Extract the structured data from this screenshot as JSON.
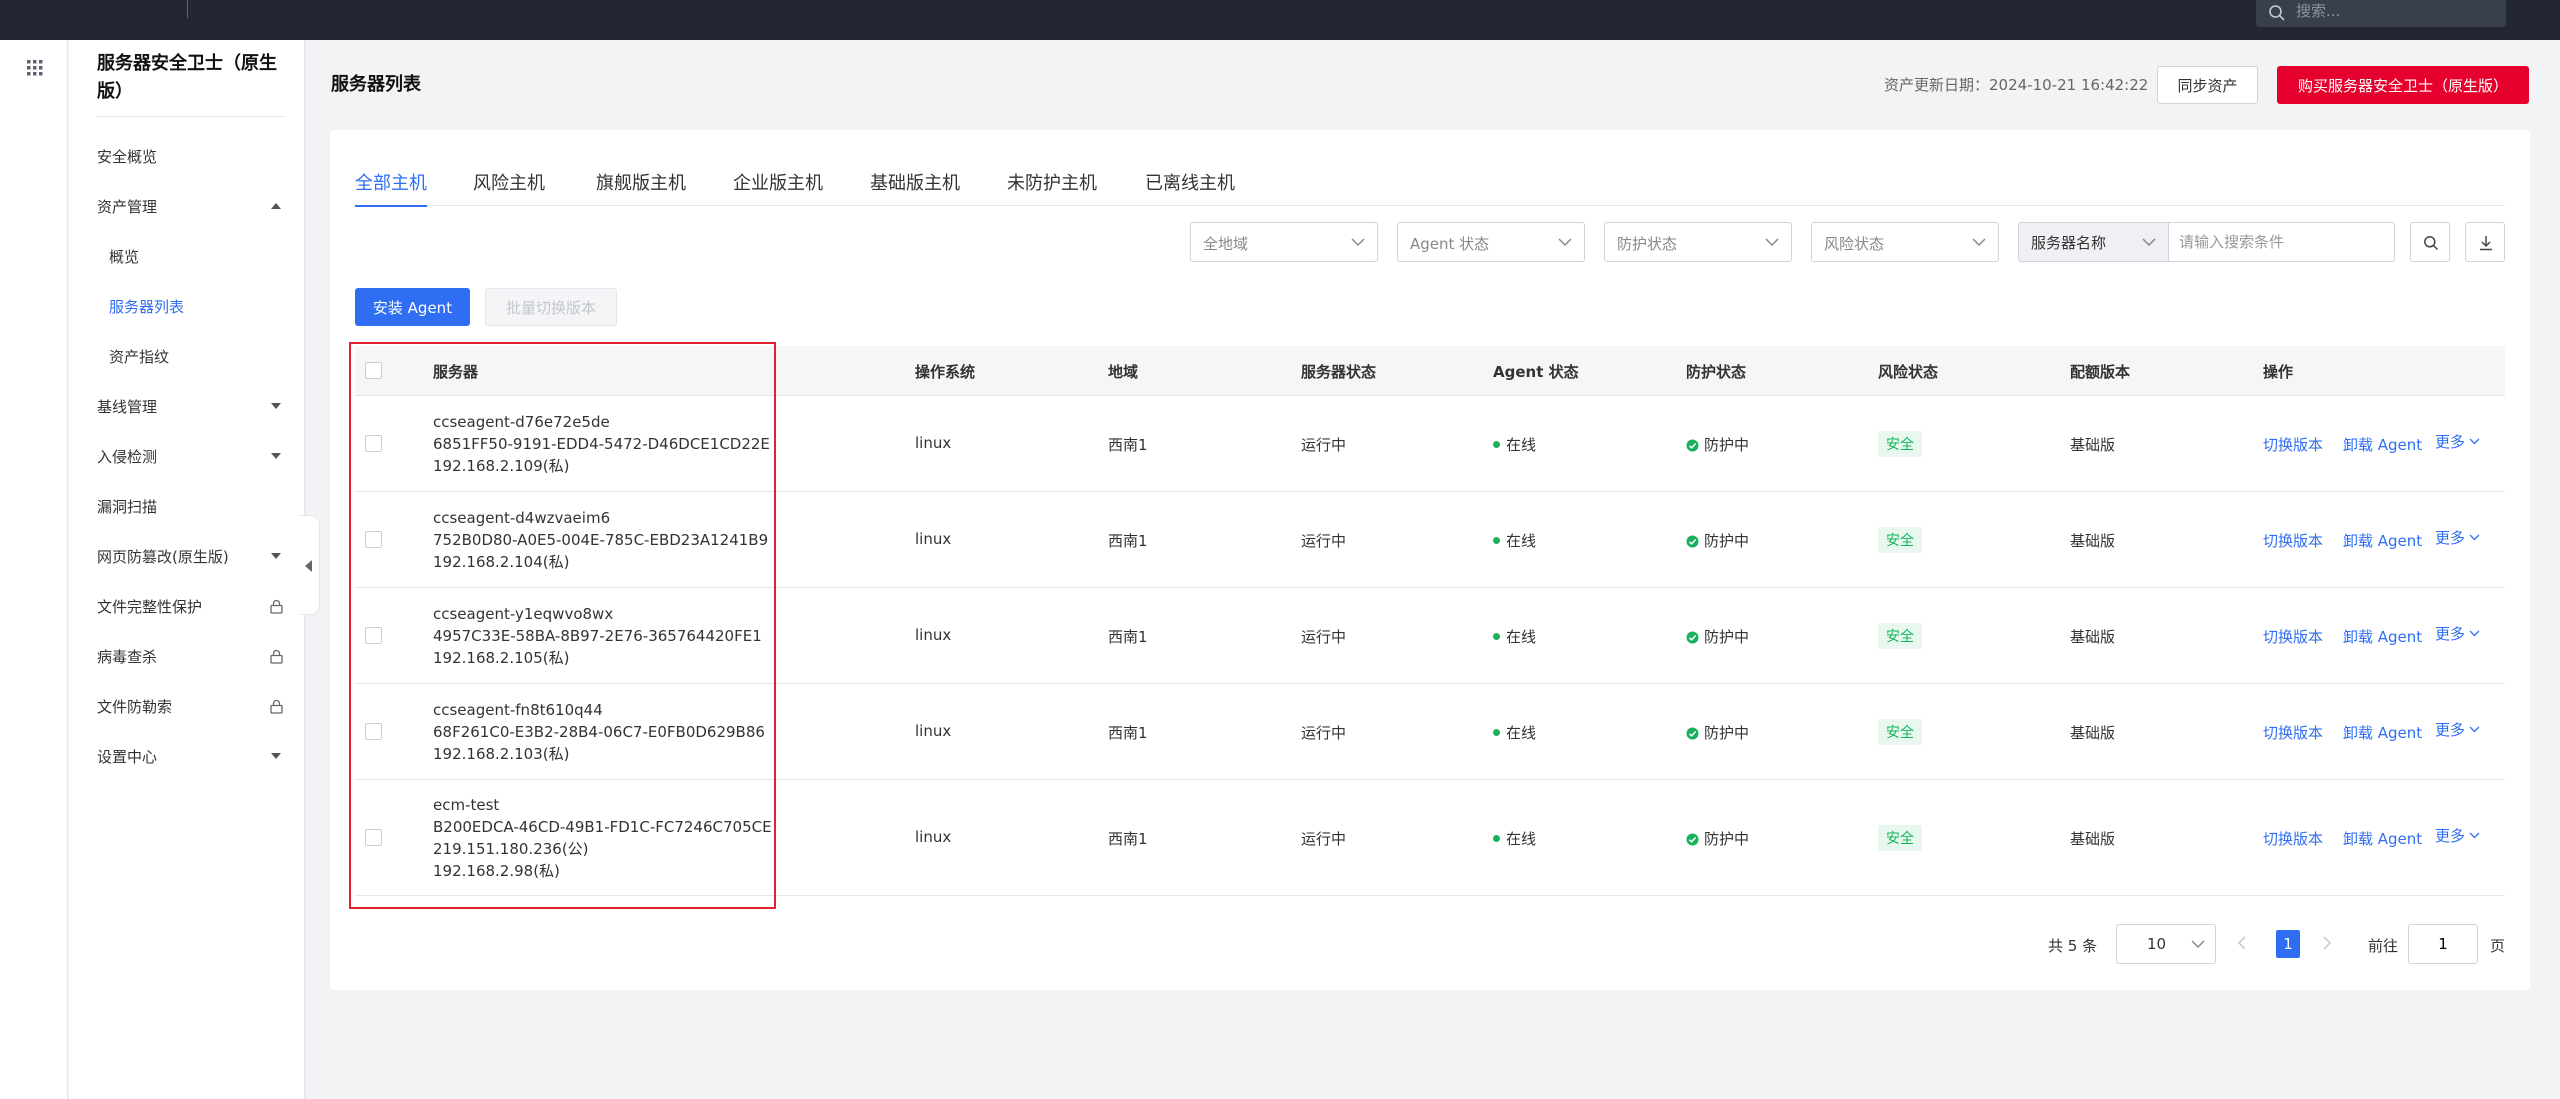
{
  "topbar": {
    "search_placeholder": "搜索..."
  },
  "sidebar": {
    "title": "服务器安全卫士（原生版）",
    "items": [
      {
        "label": "安全概览",
        "type": "item"
      },
      {
        "label": "资产管理",
        "type": "group",
        "expanded": true
      },
      {
        "label": "概览",
        "type": "sub"
      },
      {
        "label": "服务器列表",
        "type": "sub",
        "active": true
      },
      {
        "label": "资产指纹",
        "type": "sub"
      },
      {
        "label": "基线管理",
        "type": "group",
        "expanded": false
      },
      {
        "label": "入侵检测",
        "type": "group",
        "expanded": false
      },
      {
        "label": "漏洞扫描",
        "type": "item"
      },
      {
        "label": "网页防篡改(原生版)",
        "type": "group",
        "expanded": false
      },
      {
        "label": "文件完整性保护",
        "type": "locked"
      },
      {
        "label": "病毒查杀",
        "type": "locked"
      },
      {
        "label": "文件防勒索",
        "type": "locked"
      },
      {
        "label": "设置中心",
        "type": "group",
        "expanded": false
      }
    ]
  },
  "header": {
    "title": "服务器列表",
    "update_text": "资产更新日期：2024-10-21 16:42:22",
    "sync_label": "同步资产",
    "buy_label": "购买服务器安全卫士（原生版）"
  },
  "tabs": [
    "全部主机",
    "风险主机",
    "旗舰版主机",
    "企业版主机",
    "基础版主机",
    "未防护主机",
    "已离线主机"
  ],
  "filters": {
    "region": "全地域",
    "agent_status": "Agent 状态",
    "protect_status": "防护状态",
    "risk_status": "风险状态",
    "search_field": "服务器名称",
    "search_placeholder": "请输入搜索条件"
  },
  "actions": {
    "install": "安装 Agent",
    "batch_switch": "批量切换版本"
  },
  "table": {
    "columns": [
      "服务器",
      "操作系统",
      "地域",
      "服务器状态",
      "Agent 状态",
      "防护状态",
      "风险状态",
      "配额版本",
      "操作"
    ],
    "rows": [
      {
        "name": "ccseagent-d76e72e5de",
        "id": "6851FF50-9191-EDD4-5472-D46DCE1CD22E",
        "ips": [
          "192.168.2.109(私)"
        ],
        "os": "linux",
        "region": "西南1",
        "server_status": "运行中",
        "agent_status": "在线",
        "protect_status": "防护中",
        "risk_status": "安全",
        "version": "基础版"
      },
      {
        "name": "ccseagent-d4wzvaeim6",
        "id": "752B0D80-A0E5-004E-785C-EBD23A1241B9",
        "ips": [
          "192.168.2.104(私)"
        ],
        "os": "linux",
        "region": "西南1",
        "server_status": "运行中",
        "agent_status": "在线",
        "protect_status": "防护中",
        "risk_status": "安全",
        "version": "基础版"
      },
      {
        "name": "ccseagent-y1eqwvo8wx",
        "id": "4957C33E-58BA-8B97-2E76-365764420FE1",
        "ips": [
          "192.168.2.105(私)"
        ],
        "os": "linux",
        "region": "西南1",
        "server_status": "运行中",
        "agent_status": "在线",
        "protect_status": "防护中",
        "risk_status": "安全",
        "version": "基础版"
      },
      {
        "name": "ccseagent-fn8t610q44",
        "id": "68F261C0-E3B2-28B4-06C7-E0FB0D629B86",
        "ips": [
          "192.168.2.103(私)"
        ],
        "os": "linux",
        "region": "西南1",
        "server_status": "运行中",
        "agent_status": "在线",
        "protect_status": "防护中",
        "risk_status": "安全",
        "version": "基础版"
      },
      {
        "name": "ecm-test",
        "id": "B200EDCA-46CD-49B1-FD1C-FC7246C705CE",
        "ips": [
          "219.151.180.236(公)",
          "192.168.2.98(私)"
        ],
        "os": "linux",
        "region": "西南1",
        "server_status": "运行中",
        "agent_status": "在线",
        "protect_status": "防护中",
        "risk_status": "安全",
        "version": "基础版"
      }
    ],
    "row_actions": {
      "switch": "切换版本",
      "uninstall": "卸载 Agent",
      "more": "更多"
    }
  },
  "pagination": {
    "total": "共 5 条",
    "page_size": "10",
    "current": "1",
    "goto_prefix": "前往",
    "goto_value": "1",
    "goto_suffix": "页"
  }
}
